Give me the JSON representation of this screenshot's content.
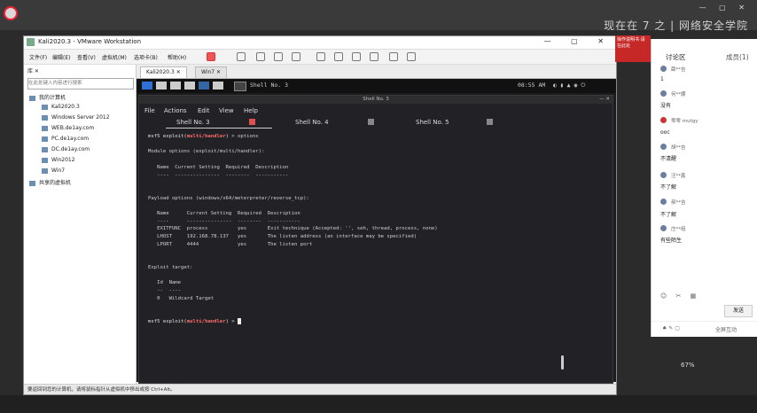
{
  "vmware": {
    "title": "Kali2020.3 - VMware Workstation",
    "menu": [
      "文件(F)",
      "编辑(E)",
      "查看(V)",
      "虚拟机(M)",
      "选项卡(B)",
      "帮助(H)"
    ],
    "library_search_placeholder": "在此处键入内容进行搜索",
    "library": {
      "root": "我的计算机",
      "items": [
        "Kali2020.3",
        "Windows Server 2012",
        "WEB.de1ay.com",
        "PC.de1ay.com",
        "DC.de1ay.com",
        "Win2012",
        "Win7"
      ],
      "shared": "共享的虚拟机"
    },
    "tabs": [
      "Kali2020.3",
      "Win7"
    ],
    "status": "要返回到您的计算机，请将鼠标指针从虚拟机中移出或按 Ctrl+Alt。"
  },
  "kali": {
    "panel_title": "Shell No. 3",
    "clock": "08:55 AM"
  },
  "terminal": {
    "window_title": "Shell No. 3",
    "menu": [
      "File",
      "Actions",
      "Edit",
      "View",
      "Help"
    ],
    "tabs": [
      "Shell No. 3",
      "Shell No. 4",
      "Shell No. 5"
    ],
    "prompt_prefix": "msf5 exploit(",
    "prompt_module": "multi/handler",
    "prompt_suffix": ") > ",
    "lines": {
      "cmd": "options",
      "module_options": "Module options (exploit/multi/handler):",
      "hdr1": "   Name  Current Setting  Required  Description",
      "sep1": "   ----  ---------------  --------  -----------",
      "payload_options": "Payload options (windows/x64/meterpreter/reverse_tcp):",
      "hdr2": "   Name      Current Setting  Required  Description",
      "sep2": "   ----      ---------------  --------  -----------",
      "row1": "   EXITFUNC  process          yes       Exit technique (Accepted: '', seh, thread, process, none)",
      "row2": "   LHOST     192.168.78.137   yes       The listen address (an interface may be specified)",
      "row3": "   LPORT     4444             yes       The listen port",
      "exploit_target": "Exploit target:",
      "hdr3": "   Id  Name",
      "sep3": "   --  ----",
      "row4": "   0   Wildcard Target"
    }
  },
  "chat": {
    "tab_discussion": "讨论区",
    "tab_members": "成员(1)",
    "messages": [
      {
        "name": "薛**吉",
        "text": "1"
      },
      {
        "name": "何**娜",
        "text": "没有"
      },
      {
        "name": "零零 mutgy",
        "text": "ooc"
      },
      {
        "name": "胡**吉",
        "text": "不清醒"
      },
      {
        "name": "汪**鑫",
        "text": "不了解"
      },
      {
        "name": "郝**吉",
        "text": "不了解"
      },
      {
        "name": "庄**组",
        "text": "有些陌生"
      }
    ],
    "send": "发送",
    "footer_right": "全屏互动",
    "zoom": "67%"
  },
  "overlay_text": "现在在 7 之 | 网络安全学院",
  "banner_text": "操作说明书 请在此处"
}
